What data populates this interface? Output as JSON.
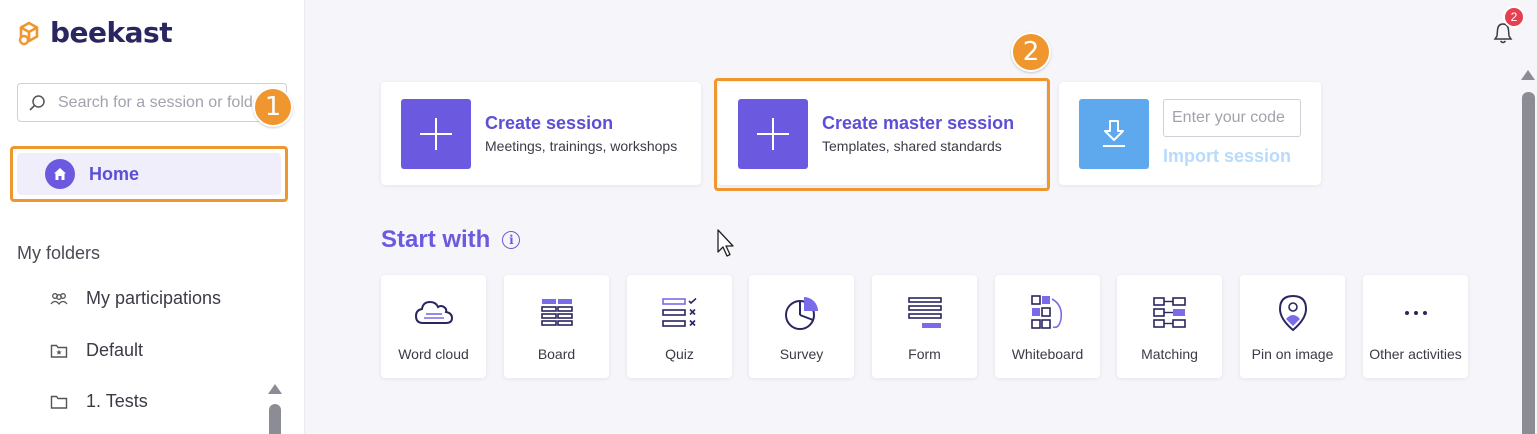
{
  "brand": {
    "name": "beekast",
    "accent": "#6b5ae0",
    "highlight": "#f0962e"
  },
  "sidebar": {
    "search_placeholder": "Search for a session or folder",
    "home_label": "Home",
    "folders_title": "My folders",
    "folders": [
      {
        "label": "My participations",
        "icon": "participants-icon"
      },
      {
        "label": "Default",
        "icon": "folder-star-icon"
      },
      {
        "label": "1. Tests",
        "icon": "folder-icon"
      }
    ]
  },
  "badges": {
    "first": "1",
    "second": "2"
  },
  "notifications": {
    "count": "2"
  },
  "actions": {
    "create_session": {
      "title": "Create session",
      "subtitle": "Meetings, trainings, workshops"
    },
    "create_master": {
      "title": "Create master session",
      "subtitle": "Templates, shared standards"
    },
    "import": {
      "placeholder": "Enter your code",
      "label": "Import session"
    }
  },
  "start_with": {
    "title": "Start with",
    "activities": [
      {
        "label": "Word cloud"
      },
      {
        "label": "Board"
      },
      {
        "label": "Quiz"
      },
      {
        "label": "Survey"
      },
      {
        "label": "Form"
      },
      {
        "label": "Whiteboard"
      },
      {
        "label": "Matching"
      },
      {
        "label": "Pin on image"
      },
      {
        "label": "Other activities"
      }
    ]
  }
}
